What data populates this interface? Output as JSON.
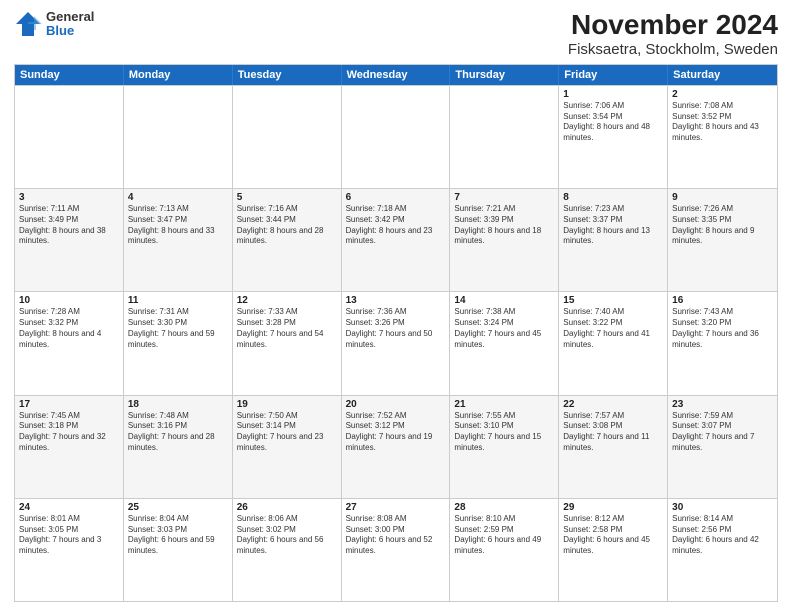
{
  "logo": {
    "general": "General",
    "blue": "Blue"
  },
  "title": "November 2024",
  "subtitle": "Fisksaetra, Stockholm, Sweden",
  "days": [
    "Sunday",
    "Monday",
    "Tuesday",
    "Wednesday",
    "Thursday",
    "Friday",
    "Saturday"
  ],
  "weeks": [
    [
      {
        "date": "",
        "sunrise": "",
        "sunset": "",
        "daylight": ""
      },
      {
        "date": "",
        "sunrise": "",
        "sunset": "",
        "daylight": ""
      },
      {
        "date": "",
        "sunrise": "",
        "sunset": "",
        "daylight": ""
      },
      {
        "date": "",
        "sunrise": "",
        "sunset": "",
        "daylight": ""
      },
      {
        "date": "",
        "sunrise": "",
        "sunset": "",
        "daylight": ""
      },
      {
        "date": "1",
        "sunrise": "Sunrise: 7:06 AM",
        "sunset": "Sunset: 3:54 PM",
        "daylight": "Daylight: 8 hours and 48 minutes."
      },
      {
        "date": "2",
        "sunrise": "Sunrise: 7:08 AM",
        "sunset": "Sunset: 3:52 PM",
        "daylight": "Daylight: 8 hours and 43 minutes."
      }
    ],
    [
      {
        "date": "3",
        "sunrise": "Sunrise: 7:11 AM",
        "sunset": "Sunset: 3:49 PM",
        "daylight": "Daylight: 8 hours and 38 minutes."
      },
      {
        "date": "4",
        "sunrise": "Sunrise: 7:13 AM",
        "sunset": "Sunset: 3:47 PM",
        "daylight": "Daylight: 8 hours and 33 minutes."
      },
      {
        "date": "5",
        "sunrise": "Sunrise: 7:16 AM",
        "sunset": "Sunset: 3:44 PM",
        "daylight": "Daylight: 8 hours and 28 minutes."
      },
      {
        "date": "6",
        "sunrise": "Sunrise: 7:18 AM",
        "sunset": "Sunset: 3:42 PM",
        "daylight": "Daylight: 8 hours and 23 minutes."
      },
      {
        "date": "7",
        "sunrise": "Sunrise: 7:21 AM",
        "sunset": "Sunset: 3:39 PM",
        "daylight": "Daylight: 8 hours and 18 minutes."
      },
      {
        "date": "8",
        "sunrise": "Sunrise: 7:23 AM",
        "sunset": "Sunset: 3:37 PM",
        "daylight": "Daylight: 8 hours and 13 minutes."
      },
      {
        "date": "9",
        "sunrise": "Sunrise: 7:26 AM",
        "sunset": "Sunset: 3:35 PM",
        "daylight": "Daylight: 8 hours and 9 minutes."
      }
    ],
    [
      {
        "date": "10",
        "sunrise": "Sunrise: 7:28 AM",
        "sunset": "Sunset: 3:32 PM",
        "daylight": "Daylight: 8 hours and 4 minutes."
      },
      {
        "date": "11",
        "sunrise": "Sunrise: 7:31 AM",
        "sunset": "Sunset: 3:30 PM",
        "daylight": "Daylight: 7 hours and 59 minutes."
      },
      {
        "date": "12",
        "sunrise": "Sunrise: 7:33 AM",
        "sunset": "Sunset: 3:28 PM",
        "daylight": "Daylight: 7 hours and 54 minutes."
      },
      {
        "date": "13",
        "sunrise": "Sunrise: 7:36 AM",
        "sunset": "Sunset: 3:26 PM",
        "daylight": "Daylight: 7 hours and 50 minutes."
      },
      {
        "date": "14",
        "sunrise": "Sunrise: 7:38 AM",
        "sunset": "Sunset: 3:24 PM",
        "daylight": "Daylight: 7 hours and 45 minutes."
      },
      {
        "date": "15",
        "sunrise": "Sunrise: 7:40 AM",
        "sunset": "Sunset: 3:22 PM",
        "daylight": "Daylight: 7 hours and 41 minutes."
      },
      {
        "date": "16",
        "sunrise": "Sunrise: 7:43 AM",
        "sunset": "Sunset: 3:20 PM",
        "daylight": "Daylight: 7 hours and 36 minutes."
      }
    ],
    [
      {
        "date": "17",
        "sunrise": "Sunrise: 7:45 AM",
        "sunset": "Sunset: 3:18 PM",
        "daylight": "Daylight: 7 hours and 32 minutes."
      },
      {
        "date": "18",
        "sunrise": "Sunrise: 7:48 AM",
        "sunset": "Sunset: 3:16 PM",
        "daylight": "Daylight: 7 hours and 28 minutes."
      },
      {
        "date": "19",
        "sunrise": "Sunrise: 7:50 AM",
        "sunset": "Sunset: 3:14 PM",
        "daylight": "Daylight: 7 hours and 23 minutes."
      },
      {
        "date": "20",
        "sunrise": "Sunrise: 7:52 AM",
        "sunset": "Sunset: 3:12 PM",
        "daylight": "Daylight: 7 hours and 19 minutes."
      },
      {
        "date": "21",
        "sunrise": "Sunrise: 7:55 AM",
        "sunset": "Sunset: 3:10 PM",
        "daylight": "Daylight: 7 hours and 15 minutes."
      },
      {
        "date": "22",
        "sunrise": "Sunrise: 7:57 AM",
        "sunset": "Sunset: 3:08 PM",
        "daylight": "Daylight: 7 hours and 11 minutes."
      },
      {
        "date": "23",
        "sunrise": "Sunrise: 7:59 AM",
        "sunset": "Sunset: 3:07 PM",
        "daylight": "Daylight: 7 hours and 7 minutes."
      }
    ],
    [
      {
        "date": "24",
        "sunrise": "Sunrise: 8:01 AM",
        "sunset": "Sunset: 3:05 PM",
        "daylight": "Daylight: 7 hours and 3 minutes."
      },
      {
        "date": "25",
        "sunrise": "Sunrise: 8:04 AM",
        "sunset": "Sunset: 3:03 PM",
        "daylight": "Daylight: 6 hours and 59 minutes."
      },
      {
        "date": "26",
        "sunrise": "Sunrise: 8:06 AM",
        "sunset": "Sunset: 3:02 PM",
        "daylight": "Daylight: 6 hours and 56 minutes."
      },
      {
        "date": "27",
        "sunrise": "Sunrise: 8:08 AM",
        "sunset": "Sunset: 3:00 PM",
        "daylight": "Daylight: 6 hours and 52 minutes."
      },
      {
        "date": "28",
        "sunrise": "Sunrise: 8:10 AM",
        "sunset": "Sunset: 2:59 PM",
        "daylight": "Daylight: 6 hours and 49 minutes."
      },
      {
        "date": "29",
        "sunrise": "Sunrise: 8:12 AM",
        "sunset": "Sunset: 2:58 PM",
        "daylight": "Daylight: 6 hours and 45 minutes."
      },
      {
        "date": "30",
        "sunrise": "Sunrise: 8:14 AM",
        "sunset": "Sunset: 2:56 PM",
        "daylight": "Daylight: 6 hours and 42 minutes."
      }
    ]
  ]
}
